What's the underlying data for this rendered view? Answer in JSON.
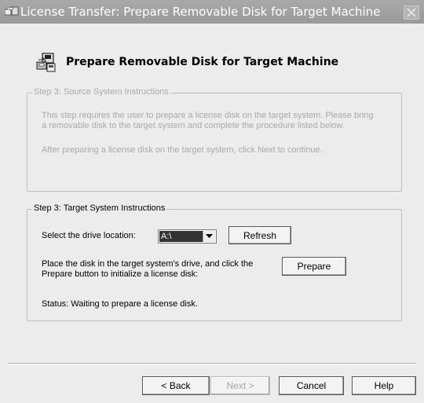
{
  "window": {
    "title": "License Transfer: Prepare Removable Disk for Target Machine"
  },
  "header": {
    "title": "Prepare Removable Disk for Target Machine"
  },
  "source_group": {
    "legend": "Step 3: Source System Instructions",
    "line1": "This step requires the user to prepare a license disk on the target system.  Please bring",
    "line2": "a removable disk to the target system and complete the procedure listed below.",
    "line3": "After preparing a license disk on the target system, click Next to continue."
  },
  "target_group": {
    "legend": "Step 3: Target System Instructions",
    "drive_label": "Select the drive location:",
    "drive_value": "A:\\",
    "refresh_label": "Refresh",
    "prepare_text_line1": "Place the disk in the target system's drive, and click the",
    "prepare_text_line2": "Prepare button to initialize a license disk:",
    "prepare_label": "Prepare",
    "status": "Status: Waiting to prepare a license disk."
  },
  "footer": {
    "back_label": "< Back",
    "next_label": "Next >",
    "cancel_label": "Cancel",
    "help_label": "Help"
  },
  "icons": {
    "title_icon": "license-transfer-icon",
    "header_icon": "removable-disk-icon",
    "close_icon": "close-icon",
    "dropdown_icon": "chevron-down-icon"
  }
}
